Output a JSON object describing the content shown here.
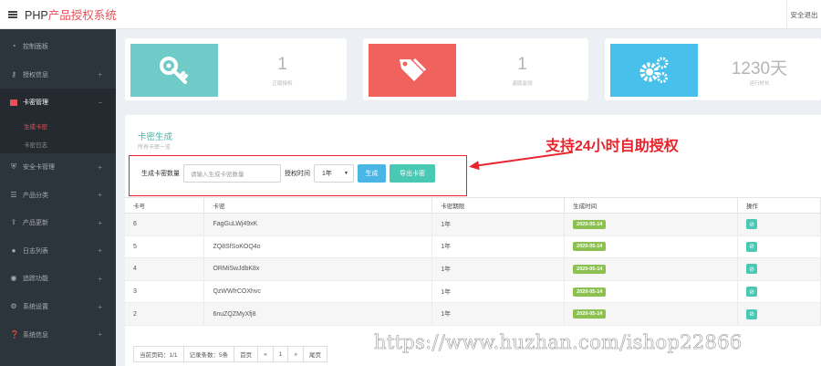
{
  "header": {
    "brand_prefix": "PHP",
    "brand_accent": "产品授权系统",
    "logout": "安全退出"
  },
  "sidebar": {
    "items": [
      {
        "label": "控制面板",
        "icon": "dashboard-icon"
      },
      {
        "label": "授权信息",
        "icon": "key-icon"
      },
      {
        "label": "卡密管理",
        "icon": "card-icon"
      },
      {
        "label": "安全卡管理",
        "icon": "shield-icon"
      },
      {
        "label": "产品分类",
        "icon": "list-icon"
      },
      {
        "label": "产品更新",
        "icon": "upload-icon"
      },
      {
        "label": "日志列表",
        "icon": "log-icon"
      },
      {
        "label": "追踪功能",
        "icon": "track-icon"
      },
      {
        "label": "系统设置",
        "icon": "cogs-icon"
      },
      {
        "label": "系统信息",
        "icon": "info-icon"
      }
    ],
    "sub_items": [
      "生成卡密",
      "卡密日志"
    ]
  },
  "cards": [
    {
      "value": "1",
      "label": "正版授权",
      "color": "#6fcbc7"
    },
    {
      "value": "1",
      "label": "盗版监测",
      "color": "#f0625e"
    },
    {
      "value": "1230天",
      "label": "运行时长",
      "color": "#48c0ec"
    }
  ],
  "panel": {
    "title": "卡密生成",
    "subtitle": "所有卡密一览",
    "form": {
      "count_label": "生成卡密数量",
      "count_placeholder": "请输入生成卡密数量",
      "duration_label": "授权时间",
      "duration_value": "1年",
      "generate_btn": "生成",
      "export_btn": "导出卡密"
    },
    "annotation": "支持24小时自助授权"
  },
  "table": {
    "headers": [
      "卡号",
      "卡密",
      "卡密期限",
      "生成时间",
      "操作"
    ],
    "rows": [
      {
        "id": "6",
        "key": "FagGuLWj49xK",
        "term": "1年",
        "date": "2020-05-14"
      },
      {
        "id": "5",
        "key": "ZQ8SfSoKOQ4o",
        "term": "1年",
        "date": "2020-05-14"
      },
      {
        "id": "4",
        "key": "ORMiSwJdbK8x",
        "term": "1年",
        "date": "2020-05-14"
      },
      {
        "id": "3",
        "key": "QzWWfrCOXhvc",
        "term": "1年",
        "date": "2020-05-14"
      },
      {
        "id": "2",
        "key": "6nuZQZMyXfj8",
        "term": "1年",
        "date": "2020-05-14"
      }
    ]
  },
  "pagination": {
    "page_info": "当前页码：1/1",
    "count_info": "记录条数：5条",
    "first": "首页",
    "prev": "«",
    "current": "1",
    "next": "»",
    "last": "尾页"
  },
  "watermark": "https://www.huzhan.com/ishop22866"
}
